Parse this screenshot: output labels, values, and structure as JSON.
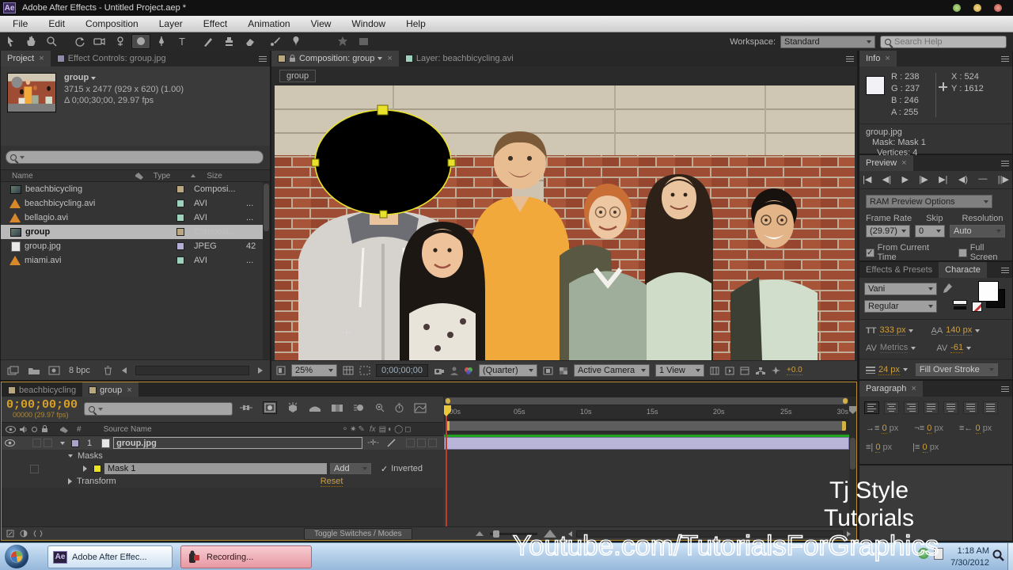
{
  "ui": {
    "close": "×",
    "check": "✓",
    "fx": "fx",
    "hash": "#"
  },
  "colors": {
    "comp_label": "#b9a77f",
    "avi_label": "#9fd2bd",
    "jpg_label": "#b3aed6",
    "layer_label": "#a9a4cc",
    "mask_label": "#e8e322",
    "accent": "#cf9f3f"
  },
  "titlebar": {
    "app_glyph": "Ae",
    "title": "Adobe After Effects - Untitled Project.aep *"
  },
  "menubar": {
    "items": [
      "File",
      "Edit",
      "Composition",
      "Layer",
      "Effect",
      "Animation",
      "View",
      "Window",
      "Help"
    ]
  },
  "toolbar": {
    "workspace_label": "Workspace:",
    "workspace_value": "Standard",
    "search_placeholder": "Search Help"
  },
  "project": {
    "tab_active": "Project",
    "tab_inactive": "Effect Controls: group.jpg",
    "preview": {
      "name": "group",
      "meta1": "3715 x 2477  (929 x 620) (1.00)",
      "meta2": "Δ 0;00;30;00, 29.97 fps"
    },
    "columns": {
      "name": "Name",
      "type": "Type",
      "size": "Size"
    },
    "rows": [
      {
        "name": "beachbicycling",
        "type": "Composi...",
        "size": "",
        "kind": "comp"
      },
      {
        "name": "beachbicycling.avi",
        "type": "AVI",
        "size": "...",
        "kind": "avi"
      },
      {
        "name": "bellagio.avi",
        "type": "AVI",
        "size": "...",
        "kind": "avi"
      },
      {
        "name": "group",
        "type": "Composi...",
        "size": "",
        "kind": "comp"
      },
      {
        "name": "group.jpg",
        "type": "JPEG",
        "size": "42",
        "kind": "jpg"
      },
      {
        "name": "miami.avi",
        "type": "AVI",
        "size": "...",
        "kind": "avi"
      }
    ],
    "bpc": "8 bpc"
  },
  "comp": {
    "tab1": "Composition: group",
    "tab2": "Layer: beachbicycling.avi",
    "breadcrumb": "group",
    "bottom": {
      "zoom": "25%",
      "timecode": "0;00;00;00",
      "resolution": "(Quarter)",
      "camera": "Active Camera",
      "view": "1 View",
      "exposure": "+0.0"
    }
  },
  "info": {
    "title": "Info",
    "r": "R : 238",
    "g": "G : 237",
    "b": "B : 246",
    "a": "A : 255",
    "x": "X : 524",
    "y": "Y : 1612",
    "line1": "group.jpg",
    "line2": "Mask: Mask 1",
    "line3": "Vertices: 4"
  },
  "preview_panel": {
    "title": "Preview",
    "transport": [
      "|◀",
      "◀|",
      "▶",
      "|▶",
      "▶|",
      "◀)",
      "—",
      "||▶"
    ],
    "ram": "RAM Preview Options",
    "frame_rate_label": "Frame Rate",
    "frame_rate": "(29.97)",
    "skip_label": "Skip",
    "skip": "0",
    "res_label": "Resolution",
    "res": "Auto",
    "cb1": "From Current Time",
    "cb2": "Full Screen"
  },
  "character": {
    "tab_inactive": "Effects & Presets",
    "tab_active": "Characte",
    "font": "Vani",
    "style": "Regular",
    "size_icon": "TT",
    "size": "333 px",
    "leading_icon": "A̲A",
    "leading": "140 px",
    "kern_icon": "AV",
    "kern": "Metrics",
    "track_icon": "AV",
    "track": "-61",
    "stroke_width": "24 px",
    "fill_order": "Fill Over Stroke"
  },
  "paragraph": {
    "title": "Paragraph",
    "fields": [
      {
        "v": "0",
        "u": "px"
      },
      {
        "v": "0",
        "u": "px"
      },
      {
        "v": "0",
        "u": "px"
      },
      {
        "v": "0",
        "u": "px"
      },
      {
        "v": "0",
        "u": "px"
      }
    ]
  },
  "timeline": {
    "tab1": "beachbicycling",
    "tab2": "group",
    "timecode": "0;00;00;00",
    "frames": "00000 (29.97 fps)",
    "col_source": "Source Name",
    "layer_num": "1",
    "layer_name": "group.jpg",
    "masks": "Masks",
    "mask1": "Mask 1",
    "mask_mode": "Add",
    "inverted": "Inverted",
    "transform": "Transform",
    "reset": "Reset",
    "ticks": [
      ":00s",
      "05s",
      "10s",
      "15s",
      "20s",
      "25s",
      "30s"
    ],
    "toggle": "Toggle Switches / Modes"
  },
  "taskbar": {
    "ae_glyph": "Ae",
    "btn1": "Adobe After Effec...",
    "btn2": "Recording...",
    "time": "1:18 AM",
    "date": "7/30/2012"
  },
  "watermark": {
    "line1": "Tj Style",
    "line2": "Tutorials",
    "bottom": "Youtube.com/TutorialsForGraphics"
  }
}
